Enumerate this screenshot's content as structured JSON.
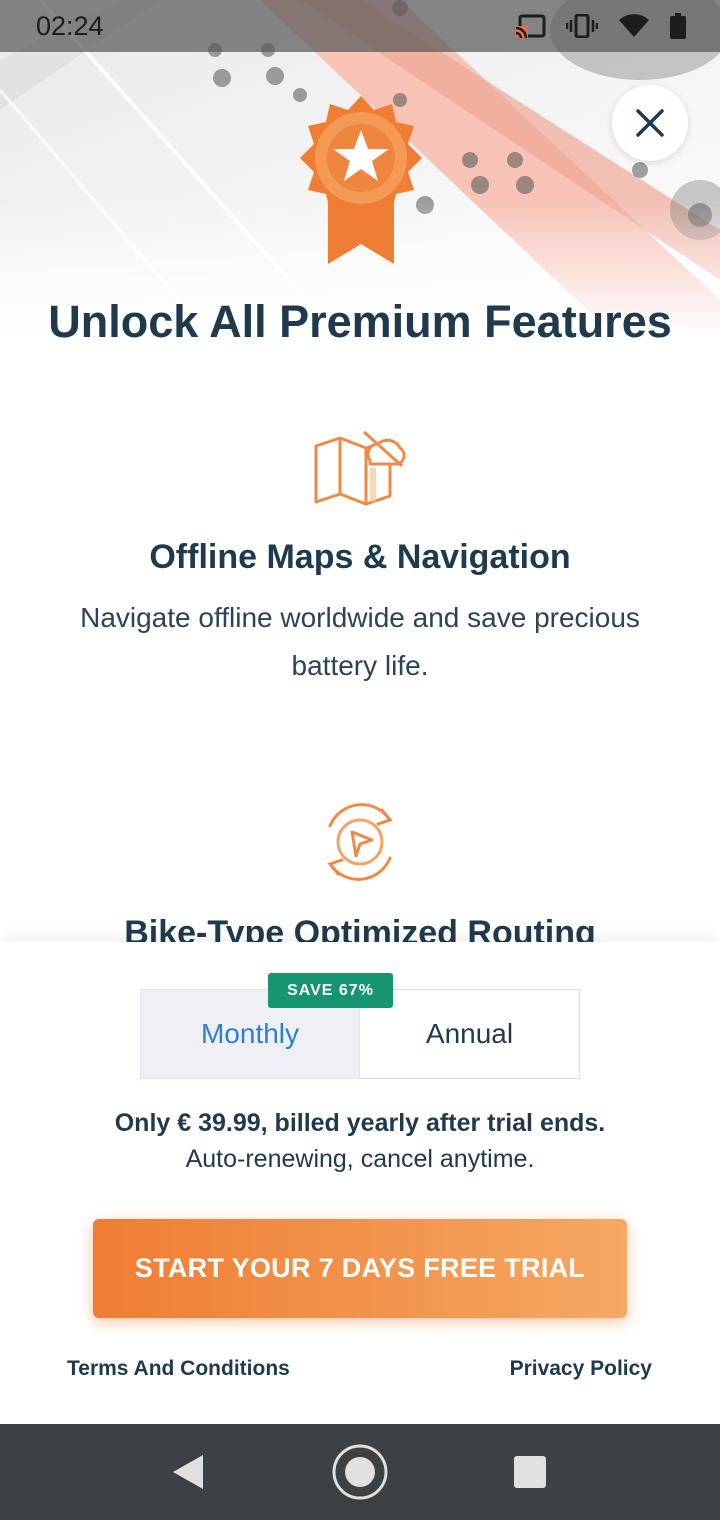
{
  "status_bar": {
    "time": "02:24",
    "icons": [
      "cast-icon",
      "vibrate-icon",
      "wifi-icon",
      "battery-icon"
    ]
  },
  "hero": {
    "badge_icon": "star-award-icon",
    "title": "Unlock All Premium Features"
  },
  "features": [
    {
      "icon": "offline-map-icon",
      "title": "Offline Maps & Navigation",
      "description": "Navigate offline worldwide and save precious battery life."
    },
    {
      "icon": "routing-cycle-icon",
      "title": "Bike-Type Optimized Routing"
    }
  ],
  "plans": {
    "options": [
      {
        "label": "Monthly",
        "selected": false
      },
      {
        "label": "Annual",
        "selected": true
      }
    ],
    "save_badge": "SAVE 67%"
  },
  "pricing": {
    "price_line": "Only € 39.99, billed yearly after trial ends.",
    "renew_line": "Auto-renewing, cancel anytime."
  },
  "cta": {
    "label": "START YOUR 7 DAYS FREE TRIAL"
  },
  "footer_links": {
    "terms": "Terms And Conditions",
    "privacy": "Privacy Policy"
  },
  "nav_bar": {
    "buttons": [
      "back-icon",
      "home-icon",
      "recents-icon"
    ]
  },
  "colors": {
    "accent_orange": "#ef7d33",
    "text_navy": "#1f3a4d",
    "selected_blue": "#2d7fd3",
    "save_green": "#179571"
  }
}
